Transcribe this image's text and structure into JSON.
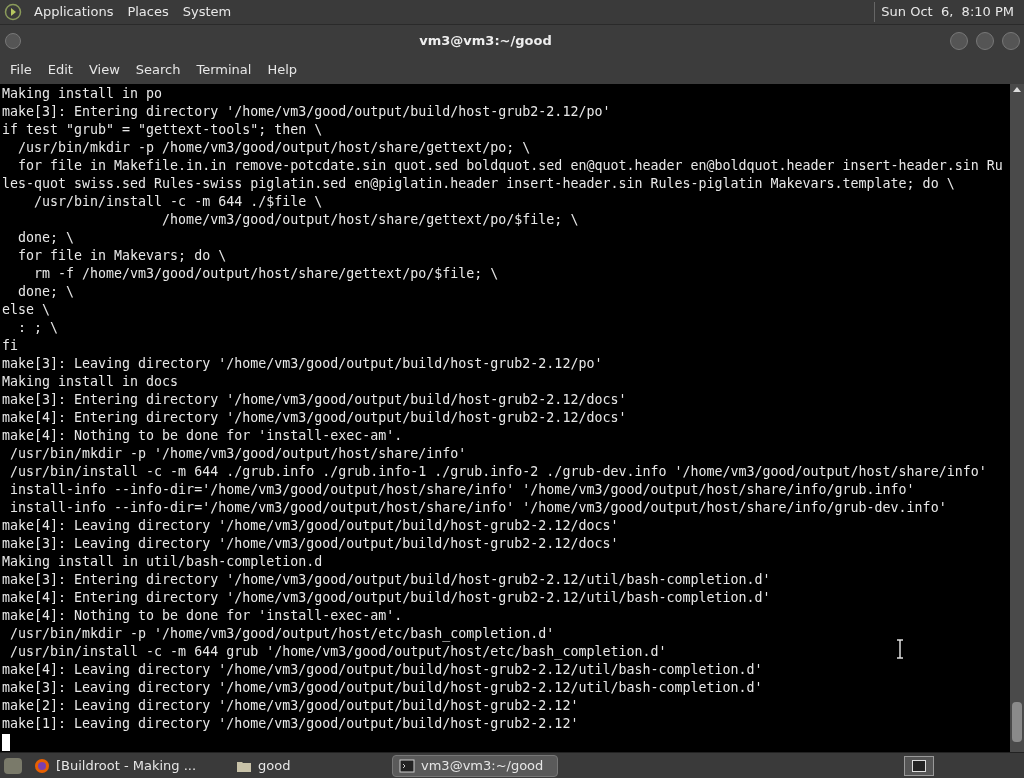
{
  "top_panel": {
    "menus": [
      "Applications",
      "Places",
      "System"
    ],
    "clock": "Sun Oct  6,  8:10 PM"
  },
  "window": {
    "title": "vm3@vm3:~/good"
  },
  "menu_bar": [
    "File",
    "Edit",
    "View",
    "Search",
    "Terminal",
    "Help"
  ],
  "terminal": {
    "lines": [
      "Making install in po",
      "make[3]: Entering directory '/home/vm3/good/output/build/host-grub2-2.12/po'",
      "if test \"grub\" = \"gettext-tools\"; then \\",
      "  /usr/bin/mkdir -p /home/vm3/good/output/host/share/gettext/po; \\",
      "  for file in Makefile.in.in remove-potcdate.sin quot.sed boldquot.sed en@quot.header en@boldquot.header insert-header.sin Ru",
      "les-quot swiss.sed Rules-swiss piglatin.sed en@piglatin.header insert-header.sin Rules-piglatin Makevars.template; do \\",
      "    /usr/bin/install -c -m 644 ./$file \\",
      "                    /home/vm3/good/output/host/share/gettext/po/$file; \\",
      "  done; \\",
      "  for file in Makevars; do \\",
      "    rm -f /home/vm3/good/output/host/share/gettext/po/$file; \\",
      "  done; \\",
      "else \\",
      "  : ; \\",
      "fi",
      "make[3]: Leaving directory '/home/vm3/good/output/build/host-grub2-2.12/po'",
      "Making install in docs",
      "make[3]: Entering directory '/home/vm3/good/output/build/host-grub2-2.12/docs'",
      "make[4]: Entering directory '/home/vm3/good/output/build/host-grub2-2.12/docs'",
      "make[4]: Nothing to be done for 'install-exec-am'.",
      " /usr/bin/mkdir -p '/home/vm3/good/output/host/share/info'",
      " /usr/bin/install -c -m 644 ./grub.info ./grub.info-1 ./grub.info-2 ./grub-dev.info '/home/vm3/good/output/host/share/info'",
      " install-info --info-dir='/home/vm3/good/output/host/share/info' '/home/vm3/good/output/host/share/info/grub.info'",
      " install-info --info-dir='/home/vm3/good/output/host/share/info' '/home/vm3/good/output/host/share/info/grub-dev.info'",
      "make[4]: Leaving directory '/home/vm3/good/output/build/host-grub2-2.12/docs'",
      "make[3]: Leaving directory '/home/vm3/good/output/build/host-grub2-2.12/docs'",
      "Making install in util/bash-completion.d",
      "make[3]: Entering directory '/home/vm3/good/output/build/host-grub2-2.12/util/bash-completion.d'",
      "make[4]: Entering directory '/home/vm3/good/output/build/host-grub2-2.12/util/bash-completion.d'",
      "make[4]: Nothing to be done for 'install-exec-am'.",
      " /usr/bin/mkdir -p '/home/vm3/good/output/host/etc/bash_completion.d'",
      " /usr/bin/install -c -m 644 grub '/home/vm3/good/output/host/etc/bash_completion.d'",
      "make[4]: Leaving directory '/home/vm3/good/output/build/host-grub2-2.12/util/bash-completion.d'",
      "make[3]: Leaving directory '/home/vm3/good/output/build/host-grub2-2.12/util/bash-completion.d'",
      "make[2]: Leaving directory '/home/vm3/good/output/build/host-grub2-2.12'",
      "make[1]: Leaving directory '/home/vm3/good/output/build/host-grub2-2.12'"
    ]
  },
  "taskbar": {
    "tasks": [
      {
        "kind": "browser",
        "label": "[Buildroot - Making ...",
        "selected": false
      },
      {
        "kind": "folder",
        "label": "good",
        "selected": false
      },
      {
        "kind": "terminal",
        "label": "vm3@vm3:~/good",
        "selected": true
      }
    ]
  }
}
